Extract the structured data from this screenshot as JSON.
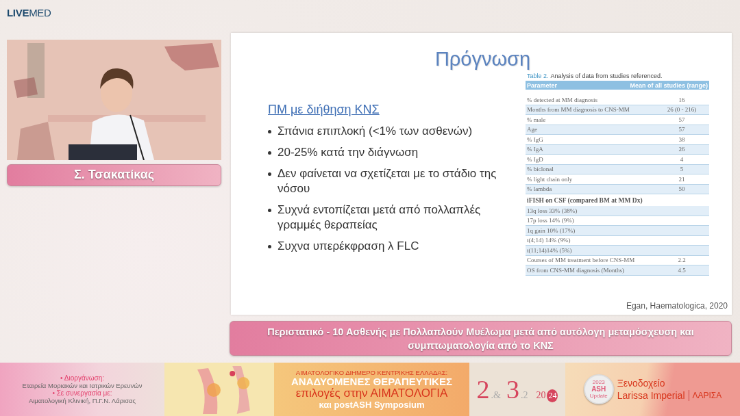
{
  "logo": "**LIVE**MED",
  "speaker": {
    "name": "Σ. Τσακατίκας"
  },
  "slide": {
    "title": "Πρόγνωση",
    "heading": "ΠΜ με διήθηση ΚΝΣ",
    "bullets": [
      "Σπάνια επιπλοκή (<1% των ασθενών)",
      "20-25% κατά την διάγνωση",
      "Δεν φαίνεται να σχετίζεται με το στάδιο της νόσου",
      "Συχνά εντοπίζεται μετά από πολλαπλές γραμμές θεραπείας",
      "Συχνα υπερέκφραση λ FLC"
    ],
    "table": {
      "caption_label": "Table 2.",
      "caption": "Analysis of data from studies referenced.",
      "columns": [
        "Parameter",
        "Mean of all studies (range)"
      ],
      "rows": [
        [
          "% detected at MM diagnosis",
          "16"
        ],
        [
          "Months from MM diagnosis to CNS-MM",
          "26 (0 - 216)"
        ],
        [
          "% male",
          "57"
        ],
        [
          "Age",
          "57"
        ],
        [
          "% IgG",
          "38"
        ],
        [
          "% IgA",
          "26"
        ],
        [
          "% IgD",
          "4"
        ],
        [
          "% biclonal",
          "5"
        ],
        [
          "% light chain only",
          "21"
        ],
        [
          "% lambda",
          "50"
        ]
      ],
      "section_title": "iFISH on CSF (compared BM at MM Dx)",
      "section_rows": [
        [
          "13q loss 33% (38%)"
        ],
        [
          "17p loss 14% (9%)"
        ],
        [
          "1q gain 10% (17%)"
        ],
        [
          "t(4;14) 14% (9%)"
        ],
        [
          "t(11;14)14% (5%)"
        ],
        [
          "Courses of MM treatment before CNS-MM",
          "2.2"
        ],
        [
          "OS from CNS-MM diagnosis (Months)",
          "4.5"
        ]
      ]
    },
    "citation": "Egan, Haematologica, 2020"
  },
  "caption": "Περιστατικό - 10 Ασθενής με Πολλαπλούν Μυέλωμα μετά από αυτόλογη μεταμόσχευση και συμπτωματολογία από το ΚΝΣ",
  "banner": {
    "organizer_label": "• Διοργάνωση:",
    "organizer": "Εταιρεία Μοριακών και Ιατρικών Ερευνών",
    "partner_label": "• Σε συνεργασία με:",
    "partner": "Αιματολογική Κλινική, Π.Γ.Ν. Λάρισας",
    "event_top": "ΑΙΜΑΤΟΛΟΓΙΚΟ ΔΙΗΜΕΡΟ ΚΕΝΤΡΙΚΗΣ ΕΛΛΑΔΑΣ:",
    "event_title": "ΑΝΑΔΥΟΜΕΝΕΣ ΘΕΡΑΠΕΥΤΙΚΕΣ",
    "event_sub": "επιλογές στην ΑΙΜΑΤΟΛΟΓΙΑ",
    "event_extra": "και postASH Symposium",
    "dates": {
      "day1": "2",
      "sep1": ".&",
      "day2": "3",
      "month": ".2",
      "year_start": "20",
      "year_end": "24"
    },
    "badge": [
      "2023",
      "ASH",
      "Update"
    ],
    "venue_top": "Ξενοδοχείο",
    "venue": "Larissa Imperial",
    "city": "ΛΑΡΙΣΑ"
  }
}
